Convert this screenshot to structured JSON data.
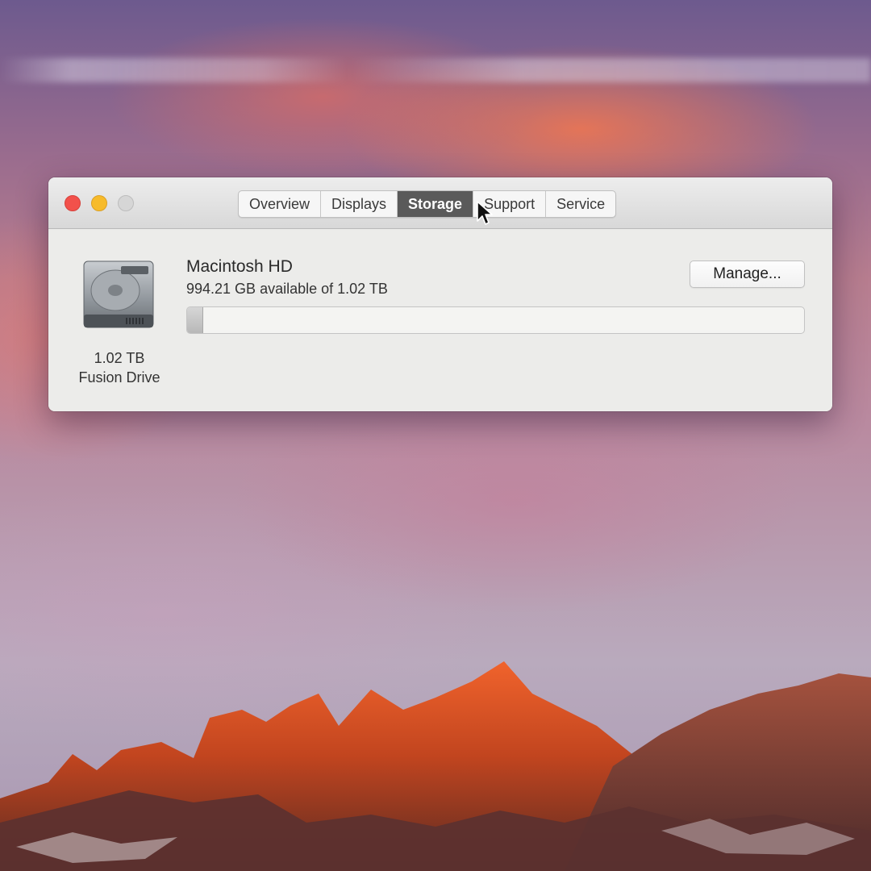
{
  "window": {
    "tabs": [
      {
        "label": "Overview",
        "selected": false
      },
      {
        "label": "Displays",
        "selected": false
      },
      {
        "label": "Storage",
        "selected": true
      },
      {
        "label": "Support",
        "selected": false
      },
      {
        "label": "Service",
        "selected": false
      }
    ]
  },
  "storage": {
    "disk": {
      "icon": "hard-drive-icon",
      "size": "1.02 TB",
      "type": "Fusion Drive"
    },
    "volume": {
      "name": "Macintosh HD",
      "availability": "994.21 GB available of 1.02 TB",
      "used_fraction": 0.025
    },
    "manage_label": "Manage..."
  },
  "colors": {
    "close": "#f2514b",
    "minimize": "#f7bb2a",
    "zoom_inactive": "#d6d6d6",
    "selected_tab": "#5a5a5a"
  }
}
